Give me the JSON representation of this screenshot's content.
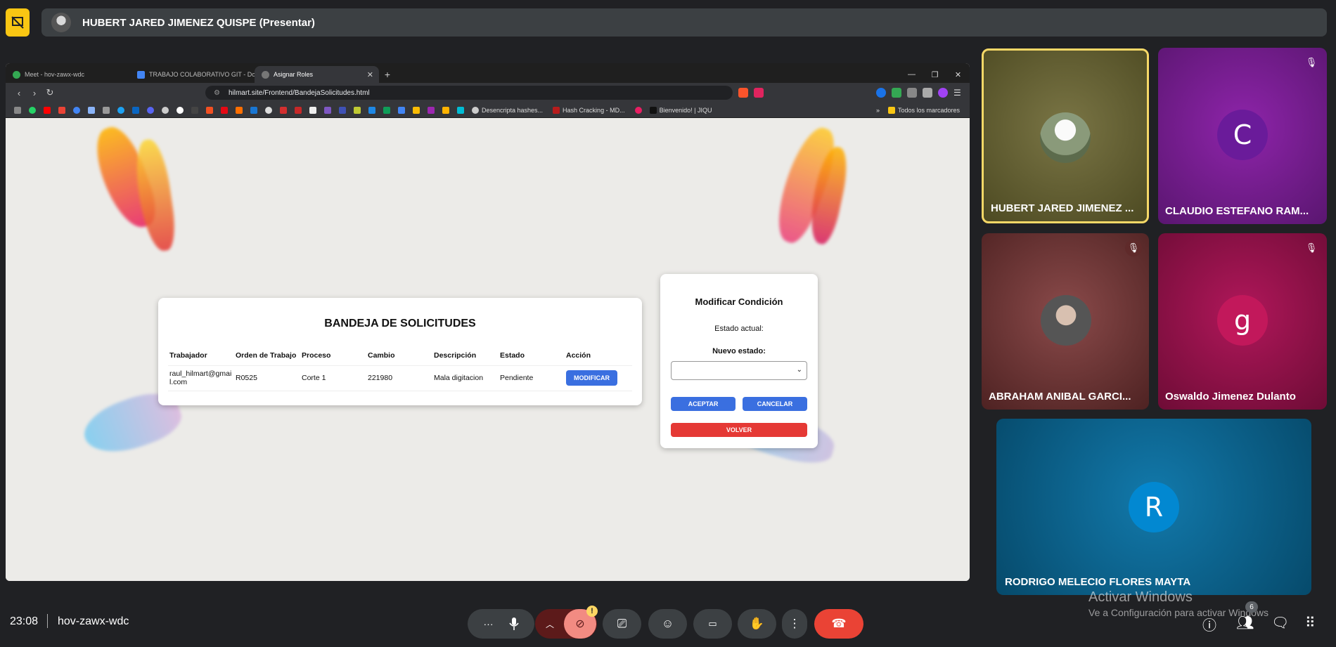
{
  "presenter_bar": {
    "title": "HUBERT JARED JIMENEZ QUISPE (Presentar)"
  },
  "browser": {
    "tabs": [
      {
        "label": "Meet - hov-zawx-wdc",
        "active": false
      },
      {
        "label": "TRABAJO COLABORATIVO GIT - Doc",
        "active": false
      },
      {
        "label": "Asignar Roles",
        "active": true
      }
    ],
    "url": "hilmart.site/Frontend/BandejaSolicitudes.html",
    "bookmarks": [
      {
        "label": "Desencripta hashes..."
      },
      {
        "label": "Hash Cracking - MD..."
      },
      {
        "label": "Bienvenido! | JIQU"
      }
    ],
    "all_bookmarks_label": "Todos los marcadores"
  },
  "card": {
    "title": "BANDEJA DE SOLICITUDES",
    "columns": [
      "Trabajador",
      "Orden de Trabajo",
      "Proceso",
      "Cambio",
      "Descripción",
      "Estado",
      "Acción"
    ],
    "rows": [
      {
        "trabajador": "raul_hilmart@gmail.com",
        "orden": "R0525",
        "proceso": "Corte 1",
        "cambio": "221980",
        "descripcion": "Mala digitacion",
        "estado": "Pendiente",
        "accion": "MODIFICAR"
      }
    ]
  },
  "modal": {
    "title": "Modificar Condición",
    "current_label": "Estado actual:",
    "new_label": "Nuevo estado:",
    "select_value": "",
    "accept": "ACEPTAR",
    "cancel": "CANCELAR",
    "back": "VOLVER"
  },
  "participants": [
    {
      "name": "HUBERT JARED JIMENEZ ...",
      "avatar": "",
      "muted": false,
      "speaking": true,
      "bg": "#6b6530"
    },
    {
      "name": "CLAUDIO ESTEFANO RAM...",
      "avatar": "C",
      "muted": true,
      "bg": "#7b1fa2"
    },
    {
      "name": "ABRAHAM ANIBAL GARCI...",
      "avatar": "",
      "muted": true,
      "bg": "#6d3535"
    },
    {
      "name": "Oswaldo Jimenez Dulanto",
      "avatar": "g",
      "muted": true,
      "bg": "#8f1446"
    },
    {
      "name": "RODRIGO MELECIO FLORES MAYTA",
      "avatar": "R",
      "muted": false,
      "bg": "#0a6d9a"
    }
  ],
  "bottom": {
    "time": "23:08",
    "meeting_code": "hov-zawx-wdc",
    "activate_title": "Activar Windows",
    "activate_sub": "Ve a Configuración para activar Windows",
    "people_count": "6"
  },
  "colors": {
    "accent_blue": "#3a6fe0",
    "danger_red": "#e53935",
    "end_call": "#ea4335"
  }
}
